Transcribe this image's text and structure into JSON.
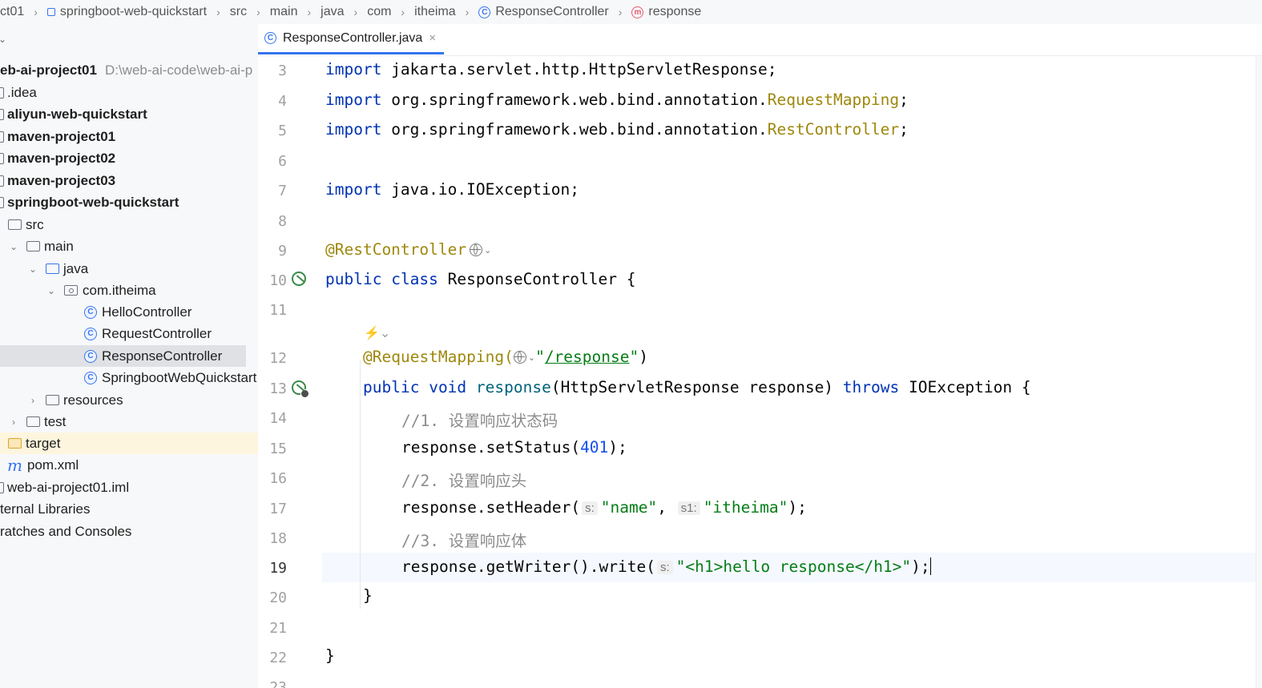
{
  "breadcrumb": [
    "ct01",
    "springboot-web-quickstart",
    "src",
    "main",
    "java",
    "com",
    "itheima",
    "ResponseController",
    "response"
  ],
  "tree": {
    "root_name": "eb-ai-project01",
    "root_path": "D:\\web-ai-code\\web-ai-p",
    "items": [
      ".idea",
      "aliyun-web-quickstart",
      "maven-project01",
      "maven-project02",
      "maven-project03",
      "springboot-web-quickstart",
      "src",
      "main",
      "java",
      "com.itheima",
      "HelloController",
      "RequestController",
      "ResponseController",
      "SpringbootWebQuickstart",
      "resources",
      "test",
      "target",
      "pom.xml",
      "web-ai-project01.iml",
      "ternal Libraries",
      "ratches and Consoles"
    ]
  },
  "tab": {
    "label": "ResponseController.java",
    "close": "×"
  },
  "editor": {
    "line_numbers": [
      "3",
      "4",
      "5",
      "6",
      "7",
      "8",
      "9",
      "10",
      "11",
      "12",
      "13",
      "14",
      "15",
      "16",
      "17",
      "18",
      "19",
      "20",
      "21",
      "22",
      "23"
    ],
    "current_line": "19",
    "ai_hint": "⚡⌄",
    "lines": {
      "l3": {
        "kw": "import",
        "rest": " jakarta.servlet.http.HttpServletResponse;"
      },
      "l4": {
        "kw": "import",
        "pre": " org.springframework.web.bind.annotation.",
        "cls": "RequestMapping",
        "end": ";"
      },
      "l5": {
        "kw": "import",
        "pre": " org.springframework.web.bind.annotation.",
        "cls": "RestController",
        "end": ";"
      },
      "l7": {
        "kw": "import",
        "rest": " java.io.IOException;"
      },
      "l9": {
        "ann": "@RestController"
      },
      "l10": {
        "kw1": "public",
        "kw2": "class",
        "rest": " ResponseController {"
      },
      "l12": {
        "ann": "@RequestMapping(",
        "q1": "\"",
        "path": "/response",
        "q2": "\"",
        "end": ")"
      },
      "l13": {
        "kw1": "public",
        "kw2": "void",
        "meth": "response",
        "mid": "(HttpServletResponse response) ",
        "kw3": "throws",
        "end": " IOException {"
      },
      "l14": "//1. 设置响应状态码",
      "l15": {
        "pre": "response.setStatus(",
        "num": "401",
        "end": ");"
      },
      "l16": "//2. 设置响应头",
      "l17": {
        "pre": "response.setHeader(",
        "hint1": "s:",
        "str1": "\"name\"",
        "comma": ", ",
        "hint2": "s1:",
        "str2": "\"itheima\"",
        "end": ");"
      },
      "l18": "//3. 设置响应体",
      "l19": {
        "pre": "response.getWriter().write(",
        "hint": "s:",
        "str": "\"<h1>hello response</h1>\"",
        "end": ");"
      },
      "l20": "}",
      "l22": "}"
    }
  },
  "colors": {
    "keyword": "#0033b3",
    "annotation": "#9e880d",
    "string": "#067d17",
    "number": "#1750eb",
    "comment": "#8c8c8c",
    "accent": "#3574f0"
  }
}
